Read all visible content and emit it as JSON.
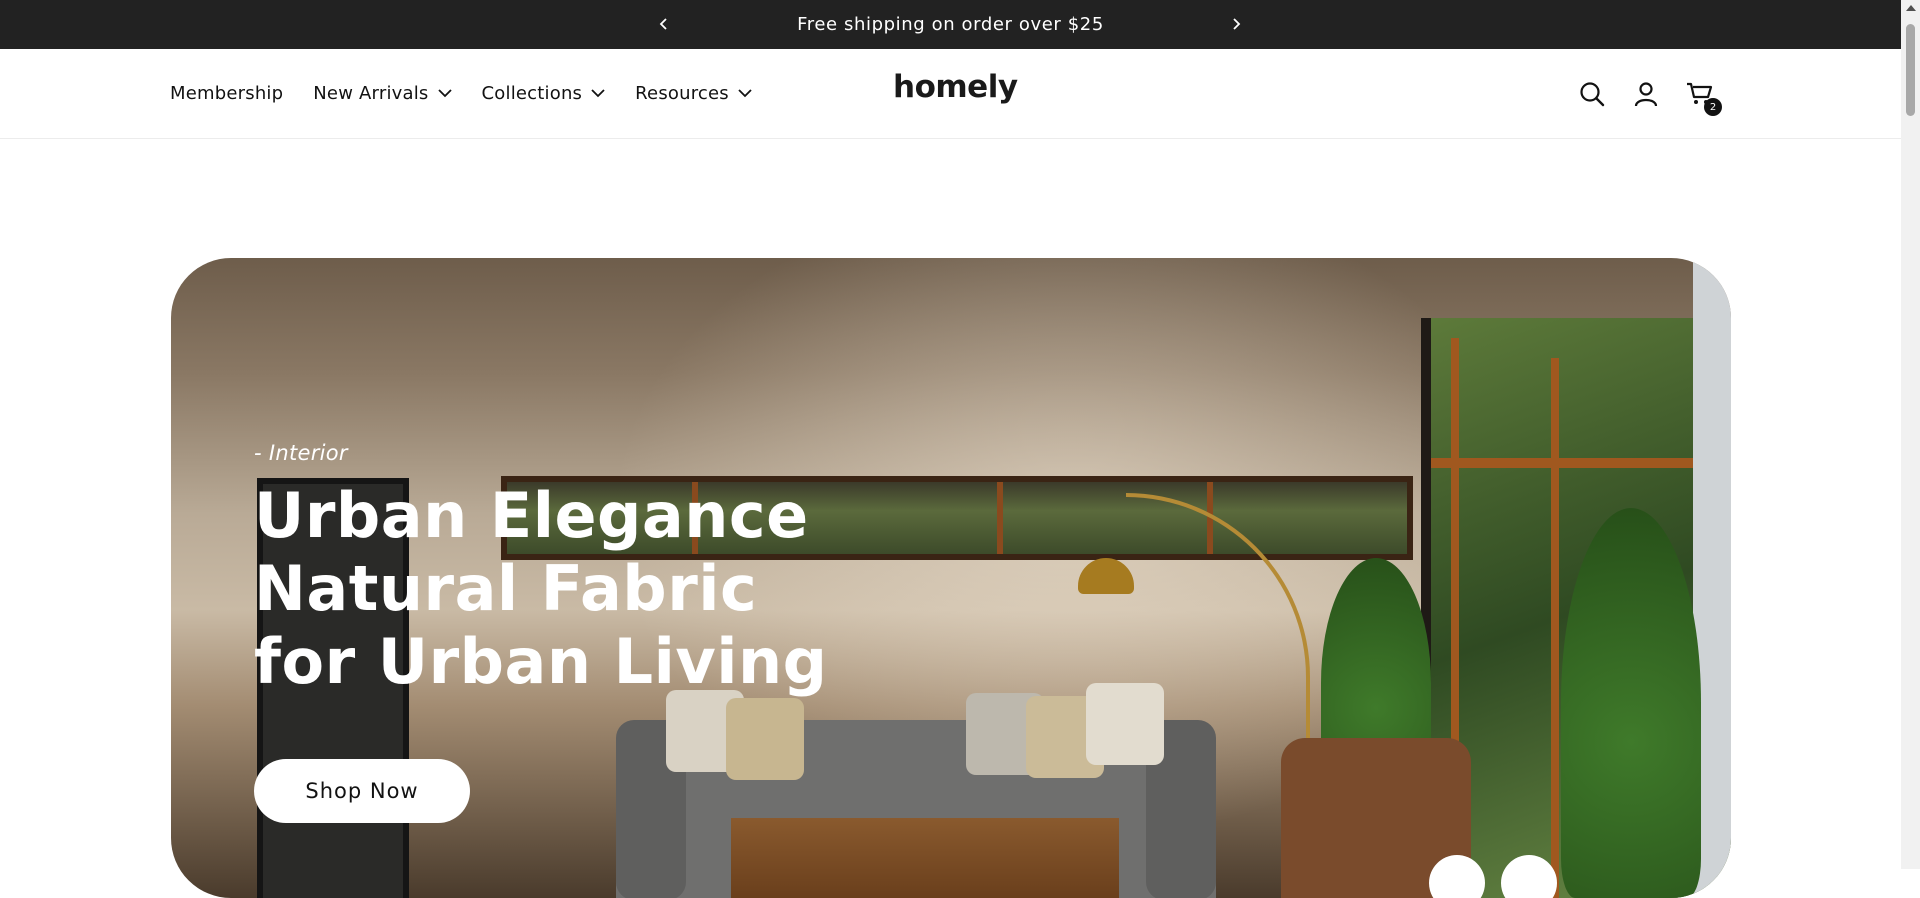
{
  "announcement": {
    "message": "Free shipping on order over $25",
    "prev_icon": "chevron-left-icon",
    "next_icon": "chevron-right-icon"
  },
  "header": {
    "nav": [
      {
        "label": "Membership",
        "has_dropdown": false
      },
      {
        "label": "New Arrivals",
        "has_dropdown": true
      },
      {
        "label": "Collections",
        "has_dropdown": true
      },
      {
        "label": "Resources",
        "has_dropdown": true
      }
    ],
    "logo": "homely",
    "icons": [
      "search-icon",
      "account-icon",
      "cart-icon"
    ],
    "cart_count": "2"
  },
  "hero": {
    "subtitle": "- Interior",
    "title_lines": [
      "Urban Elegance",
      "Natural Fabric",
      "for Urban Living"
    ],
    "cta_label": "Shop Now"
  },
  "colors": {
    "announcement_bg": "#222222",
    "text": "#121212",
    "button_bg": "#ffffff"
  }
}
